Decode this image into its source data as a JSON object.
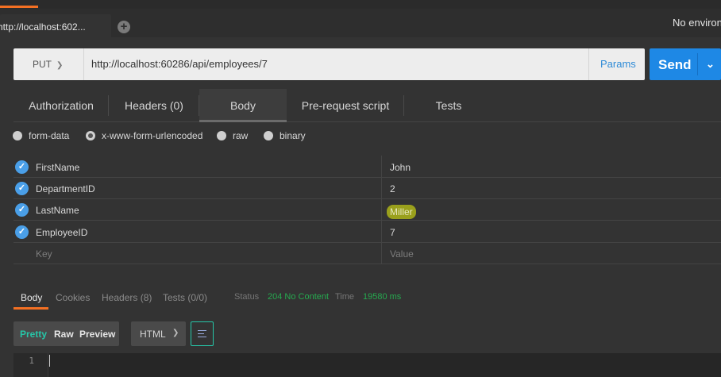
{
  "tabbar": {
    "active_tab": "http://localhost:602...",
    "add_tab_glyph": "+",
    "environment": "No environ"
  },
  "request": {
    "method": "PUT",
    "url": "http://localhost:60286/api/employees/7",
    "params_label": "Params",
    "send_label": "Send"
  },
  "request_tabs": [
    "Authorization",
    "Headers (0)",
    "Body",
    "Pre-request script",
    "Tests"
  ],
  "body_types": [
    "form-data",
    "x-www-form-urlencoded",
    "raw",
    "binary"
  ],
  "body_type_selected": "x-www-form-urlencoded",
  "params": [
    {
      "key": "FirstName",
      "value": "John"
    },
    {
      "key": "DepartmentID",
      "value": "2"
    },
    {
      "key": "LastName",
      "value": "Miller"
    },
    {
      "key": "EmployeeID",
      "value": "7"
    }
  ],
  "placeholder": {
    "key": "Key",
    "value": "Value"
  },
  "response": {
    "tabs": [
      "Body",
      "Cookies",
      "Headers (8)",
      "Tests (0/0)"
    ],
    "status_label": "Status",
    "status_value": "204 No Content",
    "time_label": "Time",
    "time_value": "19580 ms"
  },
  "format": {
    "pretty": "Pretty",
    "raw": "Raw",
    "preview": "Preview",
    "language": "HTML"
  },
  "editor": {
    "line_number": "1"
  },
  "colors": {
    "accent_orange": "#f47023",
    "send_blue": "#1e88e5",
    "status_green": "#26a94f",
    "highlight": "#9aa01c"
  }
}
